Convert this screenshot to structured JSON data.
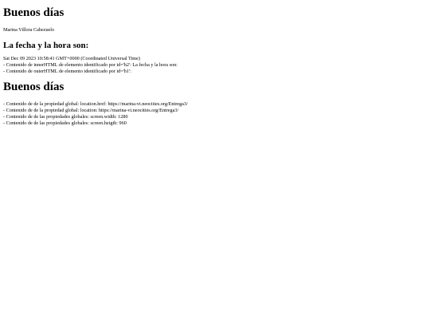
{
  "header": {
    "title": "Buenos días",
    "author": "Marina Villora Cabezuelo"
  },
  "date_section": {
    "heading": "La fecha y la hora son:",
    "lines": [
      "Sat Dec 09 2023 10:58:41 GMT+0000 (Coordinated Universal Time)",
      "- Contenido de innerHTML de elemento identificado por id='h2': La fecha y la hora son:",
      "- Contenido de outerHTML de elemento identificado por id='h1':"
    ]
  },
  "second_title": "Buenos días",
  "globals": {
    "lines": [
      "- Contenido de de la propiedad global: location.href: https://marina-vi.neocities.org/Entrega3/",
      "- Contenido de de la propiedad global: location: https://marina-vi.neocities.org/Entrega3/",
      "- Contenido de de las propiedades globales: screen.width: 1280",
      "- Contenido de de las propiedades globales: screen.heigth: 960"
    ]
  }
}
